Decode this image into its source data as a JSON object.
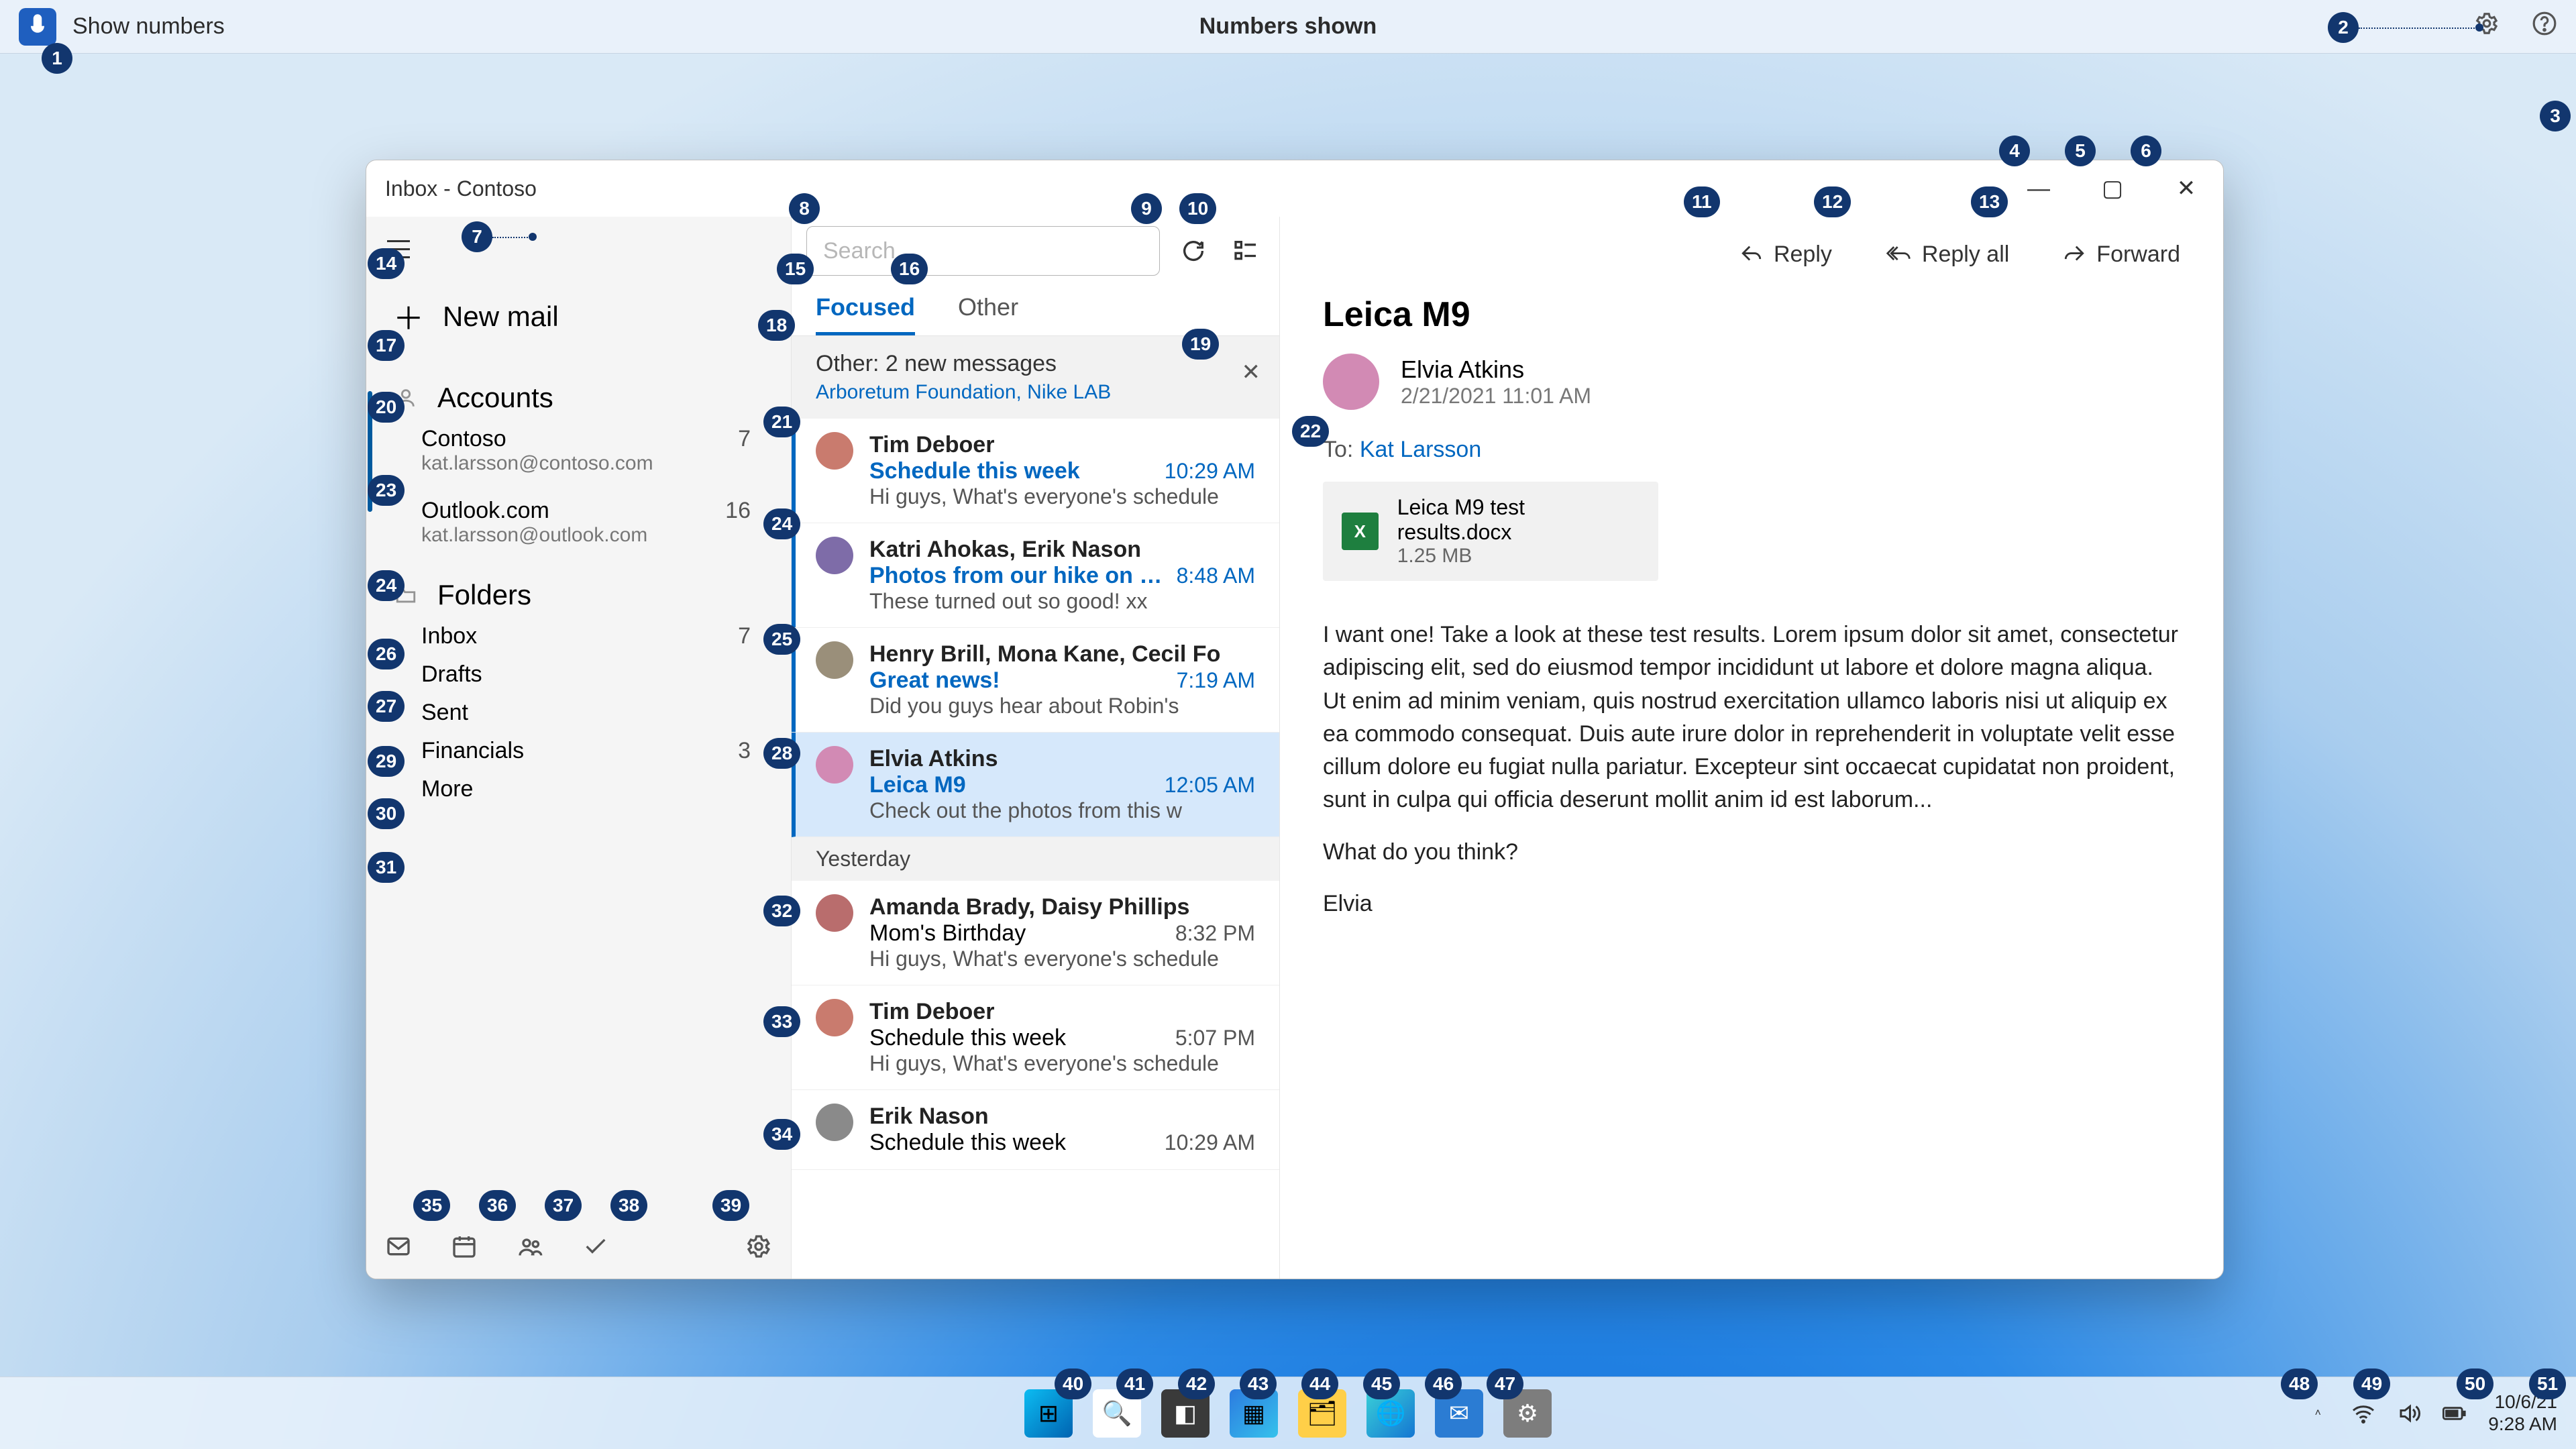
{
  "voice_bar": {
    "show_numbers": "Show numbers",
    "status": "Numbers shown"
  },
  "window": {
    "title": "Inbox - Contoso"
  },
  "nav": {
    "new_mail": "New mail",
    "accounts_label": "Accounts",
    "accounts": [
      {
        "name": "Contoso",
        "email": "kat.larsson@contoso.com",
        "count": "7"
      },
      {
        "name": "Outlook.com",
        "email": "kat.larsson@outlook.com",
        "count": "16"
      }
    ],
    "folders_label": "Folders",
    "folders": [
      {
        "name": "Inbox",
        "count": "7"
      },
      {
        "name": "Drafts",
        "count": ""
      },
      {
        "name": "Sent",
        "count": ""
      },
      {
        "name": "Financials",
        "count": "3"
      }
    ],
    "more": "More"
  },
  "search": {
    "placeholder": "Search"
  },
  "tabs": {
    "focused": "Focused",
    "other": "Other"
  },
  "other_banner": {
    "line1": "Other: 2 new messages",
    "line2": "Arboretum Foundation, Nike LAB"
  },
  "messages": [
    {
      "sender": "Tim Deboer",
      "subject": "Schedule this week",
      "preview": "Hi guys, What's everyone's schedule",
      "time": "10:29 AM",
      "unread": true
    },
    {
      "sender": "Katri Ahokas, Erik Nason",
      "subject": "Photos from our hike on Maple",
      "preview": "These turned out so good! xx",
      "time": "8:48 AM",
      "unread": true
    },
    {
      "sender": "Henry Brill, Mona Kane, Cecil Fo",
      "subject": "Great news!",
      "preview": "Did you guys hear about Robin's",
      "time": "7:19 AM",
      "unread": true
    },
    {
      "sender": "Elvia Atkins",
      "subject": "Leica M9",
      "preview": "Check out the photos from this w",
      "time": "12:05 AM",
      "unread": true,
      "selected": true
    }
  ],
  "day_separator": "Yesterday",
  "messages_prev": [
    {
      "sender": "Amanda Brady, Daisy Phillips",
      "subject": "Mom's Birthday",
      "preview": "Hi guys, What's everyone's schedule",
      "time": "8:32 PM"
    },
    {
      "sender": "Tim Deboer",
      "subject": "Schedule this week",
      "preview": "Hi guys, What's everyone's schedule",
      "time": "5:07 PM"
    },
    {
      "sender": "Erik Nason",
      "subject": "Schedule this week",
      "preview": "",
      "time": "10:29 AM"
    }
  ],
  "toolbar": {
    "reply": "Reply",
    "reply_all": "Reply all",
    "forward": "Forward"
  },
  "reading": {
    "subject": "Leica M9",
    "from_name": "Elvia Atkins",
    "from_date": "2/21/2021 11:01 AM",
    "to_label": "To:",
    "to_name": "Kat Larsson",
    "attachment": {
      "name": "Leica M9 test results.docx",
      "size": "1.25 MB"
    },
    "p1": "I want one! Take a look at these test results. Lorem ipsum dolor sit amet, consectetur adipiscing elit, sed do eiusmod tempor incididunt ut labore et dolore magna aliqua. Ut enim ad minim veniam, quis nostrud exercitation ullamco laboris nisi ut aliquip ex ea commodo consequat. Duis aute irure dolor in reprehenderit in voluptate velit esse cillum dolore eu fugiat nulla pariatur. Excepteur sint occaecat cupidatat non proident, sunt in culpa qui officia deserunt mollit anim id est laborum...",
    "p2": "What do you think?",
    "p3": "Elvia"
  },
  "taskbar": {
    "date": "10/6/21",
    "time": "9:28 AM"
  },
  "numbers": {
    "n1": "1",
    "n2": "2",
    "n3": "3",
    "n4": "4",
    "n5": "5",
    "n6": "6",
    "n7": "7",
    "n8": "8",
    "n9": "9",
    "n10": "10",
    "n11": "11",
    "n12": "12",
    "n13": "13",
    "n14": "14",
    "n15": "15",
    "n16": "16",
    "n17": "17",
    "n18": "18",
    "n19": "19",
    "n20": "20",
    "n21": "21",
    "n22": "22",
    "n23": "23",
    "n24a": "24",
    "n24b": "24",
    "n25": "25",
    "n26": "26",
    "n27": "27",
    "n28": "28",
    "n29": "29",
    "n30": "30",
    "n31": "31",
    "n32": "32",
    "n33": "33",
    "n34": "34",
    "n35": "35",
    "n36": "36",
    "n37": "37",
    "n38": "38",
    "n39": "39",
    "n40": "40",
    "n41": "41",
    "n42": "42",
    "n43": "43",
    "n44": "44",
    "n45": "45",
    "n46": "46",
    "n47": "47",
    "n48": "48",
    "n49": "49",
    "n50": "50",
    "n51": "51"
  }
}
